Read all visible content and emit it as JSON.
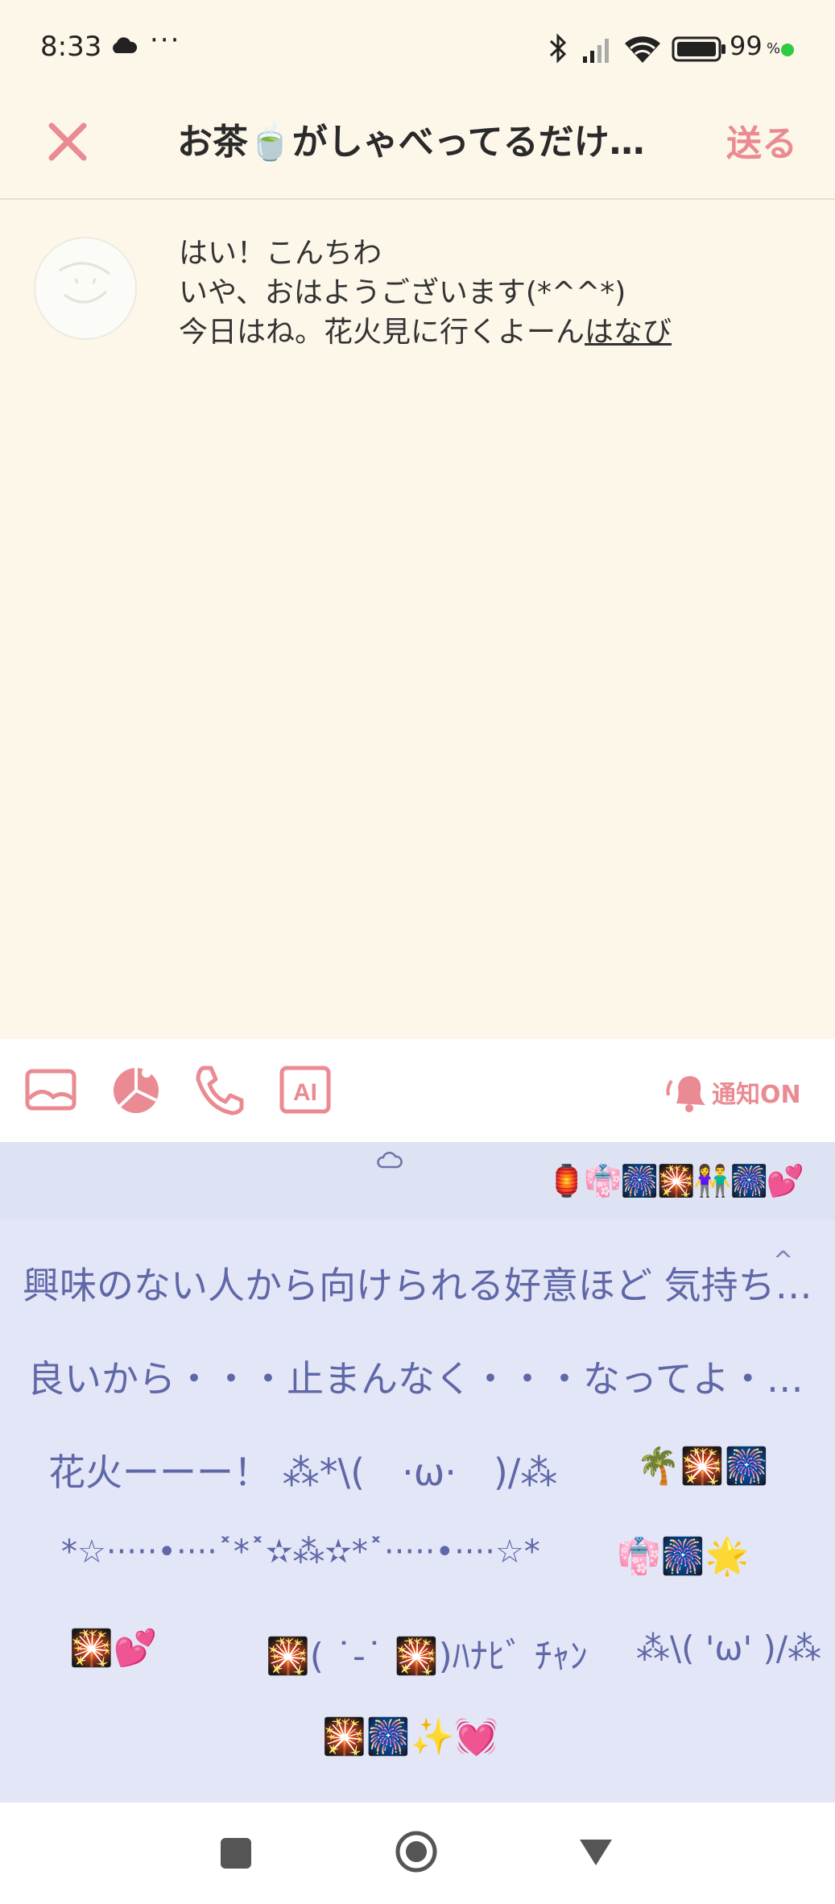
{
  "status_bar": {
    "time": "8:33",
    "dots": "···",
    "battery_percent": "99",
    "battery_suffix": "%"
  },
  "header": {
    "title": "お茶🍵がしゃべってるだけ…",
    "send_label": "送る"
  },
  "post": {
    "line1": "はい！こんちわ",
    "line2": "いや、おはようございます(*^^*)",
    "line3_text": "今日はね。花火見に行くよーん",
    "line3_tag": "はなび"
  },
  "toolbar": {
    "icons": [
      "image-icon",
      "pie-chart-icon",
      "phone-icon",
      "ai-icon"
    ],
    "notify_label": "通知ON"
  },
  "suggestions": {
    "emoji_strip": "🏮👘🎆🎇👫🎆💕",
    "items": [
      "興味のない人から向けられる好意ほど 気持ち…",
      "良いから・・・止まんなく・・・なってよ・…",
      "花火ーーー！ ⁂*\\(　·ω·　)/⁂",
      "🌴🎇🎆",
      "*☆·····•····˟*˟✫⁂✫*˟·····•····☆*",
      "👘🎆🌟",
      "🎇💕",
      "🎇( ˙-˙ 🎇)ﾊﾅﾋﾞ ﾁｬﾝ",
      "⁂\\( 'ω' )/⁂",
      "🎇🎆✨💓"
    ]
  },
  "colors": {
    "accent": "#ea8a92",
    "background": "#fdf7ea",
    "panel": "#e2e6f6",
    "suggestion_text": "#5f67a8"
  }
}
